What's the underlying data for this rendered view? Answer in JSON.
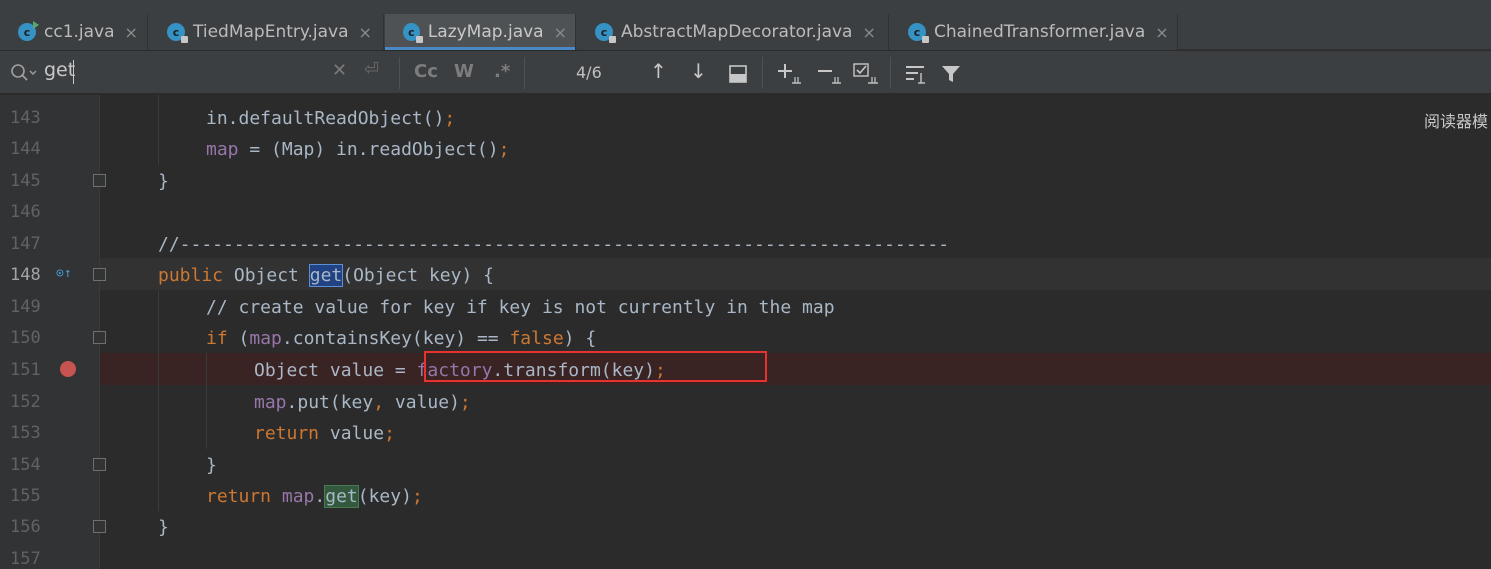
{
  "tabs": [
    {
      "name": "cc1.java",
      "active": false
    },
    {
      "name": "TiedMapEntry.java",
      "active": false
    },
    {
      "name": "LazyMap.java",
      "active": true
    },
    {
      "name": "AbstractMapDecorator.java",
      "active": false
    },
    {
      "name": "ChainedTransformer.java",
      "active": false
    }
  ],
  "tab_close": "×",
  "search": {
    "query": "get",
    "match_case_label": "Cc",
    "words_label": "W",
    "regex_label": ".*",
    "match_count": "4/6"
  },
  "side_panel_text": "阅读器模",
  "code": {
    "lines": [
      {
        "num": "143",
        "text": "in.defaultReadObject();"
      },
      {
        "num": "144",
        "text": "map = (Map) in.readObject();"
      },
      {
        "num": "145",
        "text": "}"
      },
      {
        "num": "146",
        "text": ""
      },
      {
        "num": "147",
        "text": "//-----------------------------------------------------------------------"
      },
      {
        "num": "148",
        "text": "public Object get(Object key) {"
      },
      {
        "num": "149",
        "text": "// create value for key if key is not currently in the map"
      },
      {
        "num": "150",
        "text": "if (map.containsKey(key) == false) {"
      },
      {
        "num": "151",
        "text": "Object value = factory.transform(key);"
      },
      {
        "num": "152",
        "text": "map.put(key, value);"
      },
      {
        "num": "153",
        "text": "return value;"
      },
      {
        "num": "154",
        "text": "}"
      },
      {
        "num": "155",
        "text": "return map.get(key);"
      },
      {
        "num": "156",
        "text": "}"
      },
      {
        "num": "157",
        "text": ""
      }
    ],
    "current_line": "148",
    "breakpoint_line": "151",
    "highlighted_expression": "factory.transform(key);"
  },
  "colors": {
    "keyword": "#cc7832",
    "field": "#9876aa",
    "comment": "#808080",
    "text": "#a9b7c6",
    "breakpoint": "#c75450",
    "annotation_box": "#e8322f",
    "tab_underline": "#4a88c7"
  }
}
